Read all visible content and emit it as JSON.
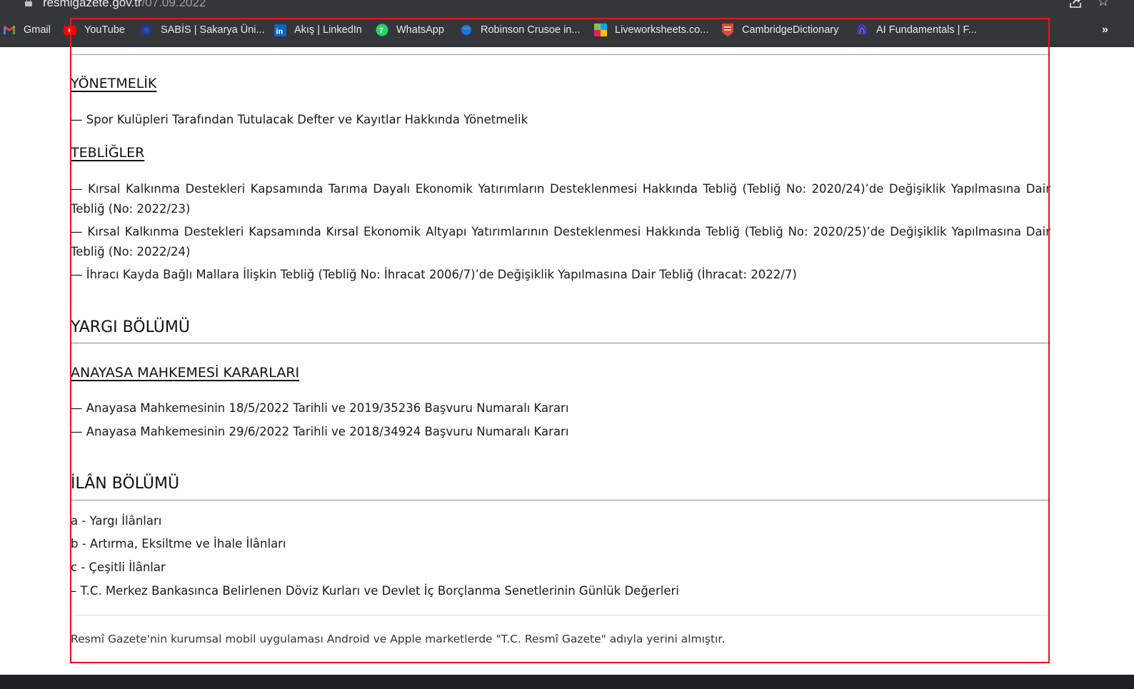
{
  "browser": {
    "url_host": "resmigazete.gov.tr",
    "url_path": "/07.09.2022",
    "more_label": "»",
    "bookmarks": [
      {
        "label": "Gmail",
        "icon": "gmail-icon"
      },
      {
        "label": "YouTube",
        "icon": "youtube-icon"
      },
      {
        "label": "SABİS | Sakarya Üni...",
        "icon": "sabis-icon"
      },
      {
        "label": "Akış | LinkedIn",
        "icon": "linkedin-icon"
      },
      {
        "label": "WhatsApp",
        "icon": "whatsapp-icon"
      },
      {
        "label": "Robinson Crusoe in...",
        "icon": "globe-icon"
      },
      {
        "label": "Liveworksheets.co...",
        "icon": "liveworksheets-icon"
      },
      {
        "label": "CambridgeDictionary",
        "icon": "cambridge-icon"
      },
      {
        "label": "AI Fundamentals | F...",
        "icon": "ai-fundamentals-icon"
      }
    ]
  },
  "page": {
    "yonetmelik": {
      "heading": "YÖNETMELİK",
      "items": [
        "— Spor Kulüpleri Tarafından Tutulacak Defter ve Kayıtlar Hakkında Yönetmelik"
      ]
    },
    "teblig": {
      "heading": "TEBLİĞLER",
      "items": [
        "— Kırsal Kalkınma Destekleri Kapsamında Tarıma Dayalı Ekonomik Yatırımların Desteklenmesi Hakkında Tebliğ (Tebliğ No: 2020/24)’de Değişiklik Yapılmasına Dair Tebliğ (No: 2022/23)",
        "— Kırsal Kalkınma Destekleri Kapsamında Kırsal Ekonomik Altyapı Yatırımlarının Desteklenmesi Hakkında Tebliğ (Tebliğ No: 2020/25)’de Değişiklik Yapılmasına Dair Tebliğ (No: 2022/24)",
        "— İhracı Kayda Bağlı Mallara İlişkin Tebliğ (Tebliğ No: İhracat 2006/7)’de Değişiklik Yapılmasına Dair Tebliğ (İhracat: 2022/7)"
      ]
    },
    "yargi": {
      "heading": "YARGI BÖLÜMÜ",
      "sub_heading": "ANAYASA MAHKEMESİ KARARLARI",
      "items": [
        "— Anayasa Mahkemesinin 18/5/2022 Tarihli ve 2019/35236 Başvuru Numaralı Kararı",
        "— Anayasa Mahkemesinin 29/6/2022 Tarihli ve 2018/34924 Başvuru Numaralı Kararı"
      ]
    },
    "ilan": {
      "heading": "İLÂN BÖLÜMÜ",
      "items": [
        "a - Yargı İlânları",
        "b - Artırma, Eksiltme ve İhale İlânları",
        "c - Çeşitli İlânlar",
        "– T.C. Merkez Bankasınca Belirlenen Döviz Kurları ve Devlet İç Borçlanma Senetlerinin Günlük Değerleri"
      ]
    },
    "footer_note": "Resmî Gazete'nin kurumsal mobil uygulaması Android ve Apple marketlerde \"T.C. Resmî Gazete\" adıyla yerini almıştır."
  },
  "colors": {
    "chrome_bg": "#35363a",
    "annotation_border": "#e8141b"
  }
}
